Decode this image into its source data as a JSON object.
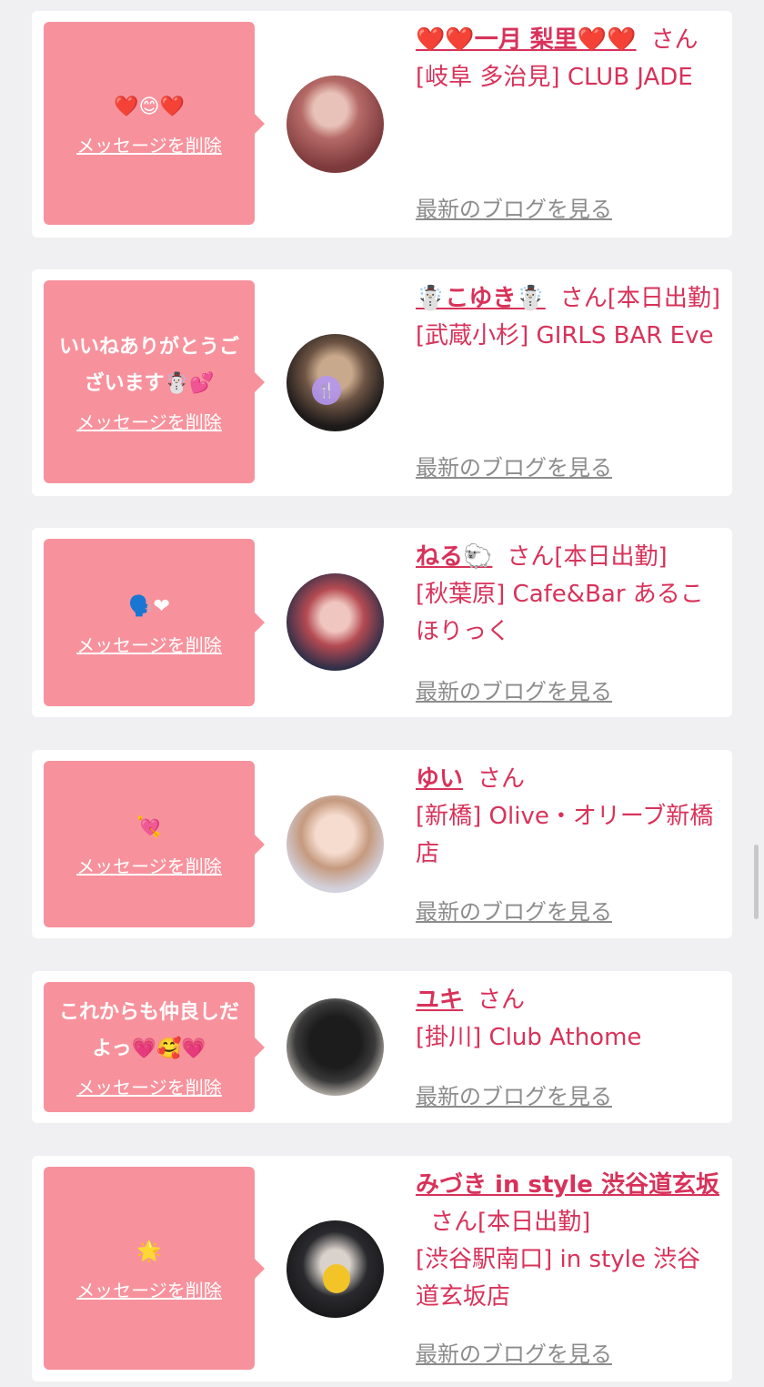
{
  "entries": [
    {
      "message": "❤️😊❤️",
      "delete_label": "メッセージを削除",
      "name": "❤️❤️一月 梨里❤️❤️",
      "suffix": "さん",
      "shop": "[岐阜 多治見] CLUB JADE",
      "blog_label": "最新のブログを見る"
    },
    {
      "message": "いいねありがとうございます☃️💕",
      "delete_label": "メッセージを削除",
      "name": "☃️こゆき☃️",
      "suffix": "さん[本日出勤]",
      "shop": "[武蔵小杉] GIRLS BAR Eve",
      "blog_label": "最新のブログを見る"
    },
    {
      "message": "🗣️❤︎",
      "delete_label": "メッセージを削除",
      "name": "ねる🐑",
      "suffix": "さん[本日出勤]",
      "shop": "[秋葉原] Cafe&Bar あるこほりっく",
      "blog_label": "最新のブログを見る"
    },
    {
      "message": "💘",
      "delete_label": "メッセージを削除",
      "name": "ゆい",
      "suffix": "さん",
      "shop": "[新橋] Olive・オリーブ新橋店",
      "blog_label": "最新のブログを見る"
    },
    {
      "message": "これからも仲良しだよっ💗🥰💗",
      "delete_label": "メッセージを削除",
      "name": "ユキ",
      "suffix": "さん",
      "shop": "[掛川] Club Athome",
      "blog_label": "最新のブログを見る"
    },
    {
      "message": "🌟",
      "delete_label": "メッセージを削除",
      "name": "みづき in style 渋谷道玄坂",
      "suffix": "さん[本日出勤]",
      "shop": "[渋谷駅南口] in style 渋谷道玄坂店",
      "blog_label": "最新のブログを見る"
    }
  ],
  "colors": {
    "accent": "#d8325a",
    "bubble": "#f7929d",
    "card": "#ffffff",
    "background": "#f0f0f2",
    "link_gray": "#8c8c8c"
  }
}
